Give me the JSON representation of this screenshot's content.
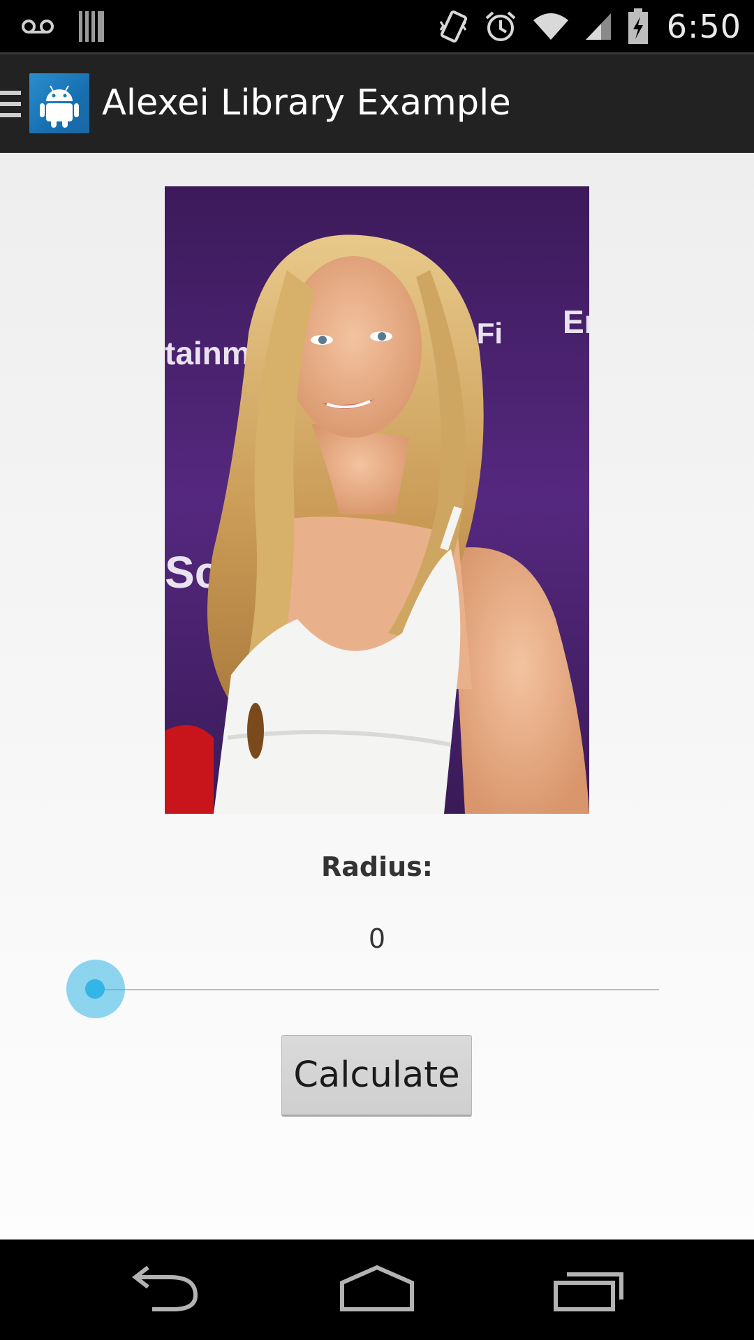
{
  "status_bar": {
    "time": "6:50",
    "icons": [
      "voicemail-icon",
      "storage-icon",
      "vibrate-icon",
      "alarm-icon",
      "wifi-icon",
      "signal-icon",
      "battery-icon"
    ]
  },
  "action_bar": {
    "title": "Alexei Library Example",
    "icons": [
      "drawer-icon",
      "android-app-icon"
    ]
  },
  "main": {
    "radius_label": "Radius:",
    "radius_value": "0",
    "slider": {
      "value": 0,
      "min": 0
    },
    "calculate_label": "Calculate"
  },
  "nav_bar": {
    "icons": [
      "back-icon",
      "home-icon",
      "recents-icon"
    ]
  },
  "colors": {
    "accent": "#33b5e5",
    "photo_background": "#4a2470"
  }
}
